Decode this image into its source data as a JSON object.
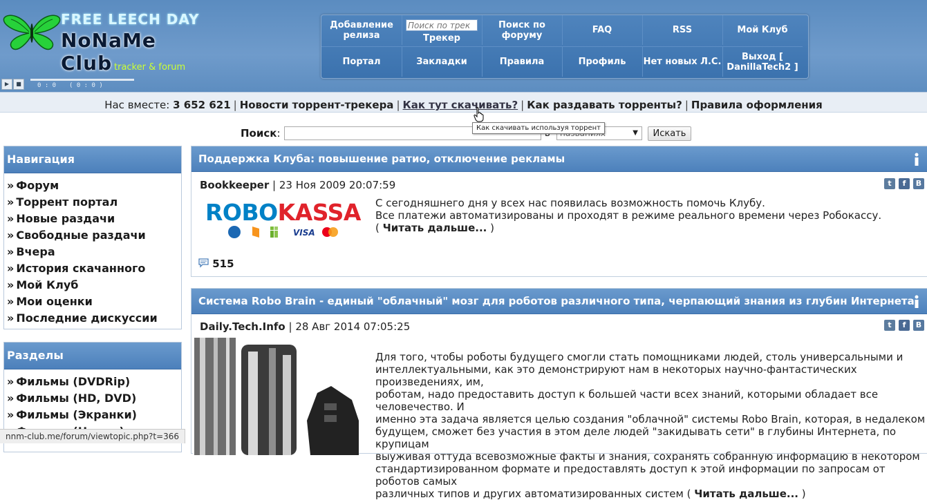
{
  "header": {
    "banner": "FREE LEECH DAY",
    "site_name": "NoNaMe Club",
    "tagline": "tracker & forum",
    "player": {
      "time_left": "0 : 0",
      "time_right": "( 0 : 0 )"
    }
  },
  "topnav": {
    "items": [
      {
        "label": "Добавление релиза"
      },
      {
        "label": "Трекер",
        "search_placeholder": "Поиск по трек"
      },
      {
        "label": "Поиск по форуму"
      },
      {
        "label": "FAQ"
      },
      {
        "label": "RSS"
      },
      {
        "label": "Мой Клуб"
      },
      {
        "label": "Портал"
      },
      {
        "label": "Закладки"
      },
      {
        "label": "Правила"
      },
      {
        "label": "Профиль"
      },
      {
        "label": "Нет новых Л.С."
      },
      {
        "label": "Выход [ DanillaTech2 ]"
      }
    ]
  },
  "infobar": {
    "together_label": "Нас вместе:",
    "together_count": "3 652 621",
    "links": [
      "Новости торрент-трекера",
      "Как тут скачивать?",
      "Как раздавать торренты?",
      "Правила оформления"
    ],
    "separator": "|",
    "tooltip": "Как скачивать используя торрент"
  },
  "search": {
    "label": "Поиск",
    "colon": ":",
    "in_label": "в",
    "select_value": "названиях",
    "button": "Искать"
  },
  "sidebar": {
    "nav_title": "Навигация",
    "nav_items": [
      "Форум",
      "Торрент портал",
      "Новые раздачи",
      "Свободные раздачи",
      "Вчера",
      "История скачанного",
      "Мой Клуб",
      "Мои оценки",
      "Последние дискуссии"
    ],
    "sections_title": "Разделы",
    "section_items": [
      "Фильмы (DVDRip)",
      "Фильмы (HD, DVD)",
      "Фильмы (Экранки)",
      "Фильмы (Новые)"
    ],
    "chevron": "»"
  },
  "posts": [
    {
      "title": "Поддержка Клуба: повышение ратио, отключение рекламы",
      "author": "Bookkeeper",
      "date": "23 Ноя 2009 20:07:59",
      "logo_part1": "ROBO",
      "logo_part2": "KASSA",
      "visa": "VISA",
      "line1": "С сегодняшнего дня у всех нас появилась возможность помочь Клубу.",
      "line2": "Все платежи автоматизированы и проходят в режиме реального времени через Робокассу.",
      "read_more_open": "( ",
      "read_more": "Читать дальше...",
      "read_more_close": " )",
      "comments": "515"
    },
    {
      "title": "Система Robo Brain - единый \"облачный\" мозг для роботов различного типа, черпающий знания из глубин Интернета",
      "author": "Daily.Tech.Info",
      "date": "28 Авг 2014 07:05:25",
      "lines": [
        "Для того, чтобы роботы будущего смогли стать помощниками людей, столь универсальными и",
        "интеллектуальными, как это демонстрируют нам в некоторых научно-фантастических произведениях, им,",
        "роботам, надо предоставить доступ к большей части всех знаний, которыми обладает все человечество. И",
        "именно эта задача является целью создания \"облачной\" системы Robo Brain, которая, в недалеком",
        "будущем, сможет без участия в этом деле людей \"закидывать сети\" в глубины Интернета, по крупицам",
        "выуживая оттуда всевозможные факты и знания, сохранять собранную информацию в некотором",
        "стандартизированном формате и предоставлять доступ к этой информации по запросам от роботов самых",
        "различных типов и других автоматизированных систем"
      ],
      "read_more_open": " ( ",
      "read_more": "Читать дальше...",
      "read_more_close": " )"
    }
  ],
  "social": {
    "twitter": "t",
    "facebook": "f",
    "vk": "B"
  },
  "statusbar": "nnm-club.me/forum/viewtopic.php?t=366",
  "colors": {
    "header_bg": "#6f9bcb",
    "nav_bg": "#3b72ae",
    "box_title": "#4c80bb",
    "robokassa_blue": "#0081c6",
    "robokassa_red": "#e0232b"
  }
}
